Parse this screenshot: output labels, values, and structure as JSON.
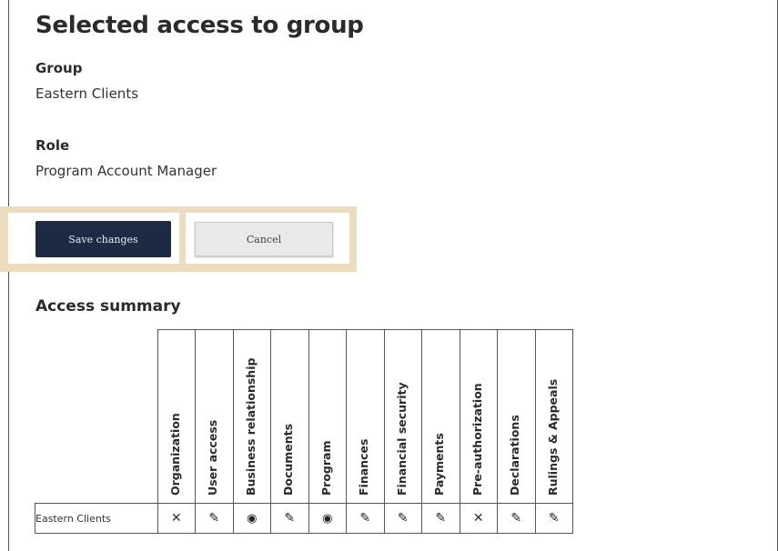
{
  "page": {
    "title": "Selected access to group",
    "group_label": "Group",
    "group_value": "Eastern Clients",
    "role_label": "Role",
    "role_value": "Program Account Manager"
  },
  "actions": {
    "save_label": "Save changes",
    "cancel_label": "Cancel"
  },
  "summary": {
    "heading": "Access summary",
    "columns": [
      "Organization",
      "User access",
      "Business relationship",
      "Documents",
      "Program",
      "Finances",
      "Financial security",
      "Payments",
      "Pre-authorization",
      "Declarations",
      "Rulings & Appeals"
    ],
    "rows": [
      {
        "label": "Eastern Clients",
        "cells": [
          "none",
          "edit",
          "view",
          "edit",
          "view",
          "edit",
          "edit",
          "edit",
          "none",
          "edit",
          "edit"
        ]
      }
    ],
    "symbols": {
      "none": "✕",
      "edit": "✎",
      "view": "◉"
    }
  },
  "colors": {
    "primary_button": "#1c2a43",
    "highlight": "#ecdcc0"
  }
}
